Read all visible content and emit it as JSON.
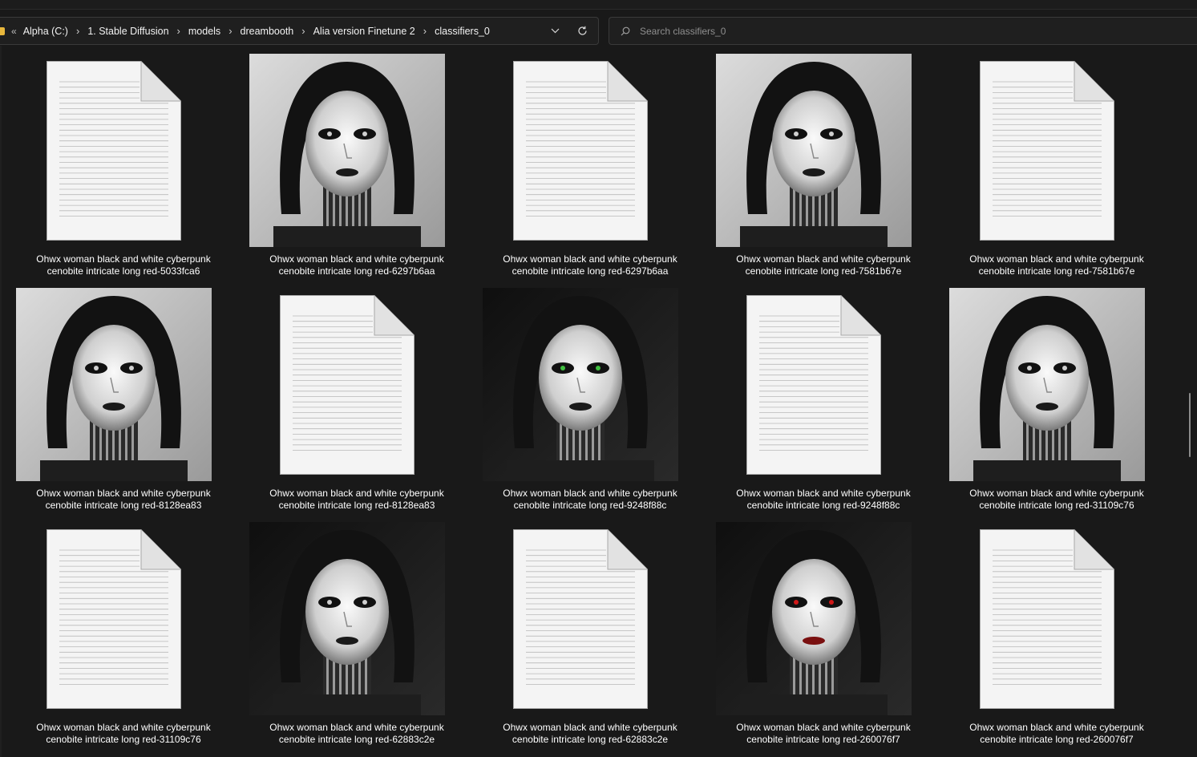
{
  "address": {
    "overflow_symbol": "«",
    "crumbs": [
      {
        "label": "Alpha (C:)"
      },
      {
        "label": "1. Stable Diffusion"
      },
      {
        "label": "models"
      },
      {
        "label": "dreambooth"
      },
      {
        "label": "Alia version Finetune 2"
      },
      {
        "label": "classifiers_0"
      }
    ]
  },
  "search": {
    "placeholder": "Search classifiers_0"
  },
  "files": [
    {
      "line1": "Ohwx woman black and white cyberpunk",
      "line2": "cenobite intricate long red-5033fca6",
      "kind": "text-file"
    },
    {
      "line1": "Ohwx woman black and white cyberpunk",
      "line2": "cenobite intricate long red-6297b6aa",
      "kind": "image"
    },
    {
      "line1": "Ohwx woman black and white cyberpunk",
      "line2": "cenobite intricate long red-6297b6aa",
      "kind": "text-file"
    },
    {
      "line1": "Ohwx woman black and white cyberpunk",
      "line2": "cenobite intricate long red-7581b67e",
      "kind": "image"
    },
    {
      "line1": "Ohwx woman black and white cyberpunk",
      "line2": "cenobite intricate long red-7581b67e",
      "kind": "text-file"
    },
    {
      "line1": "Ohwx woman black and white cyberpunk",
      "line2": "cenobite intricate long red-8128ea83",
      "kind": "image"
    },
    {
      "line1": "Ohwx woman black and white cyberpunk",
      "line2": "cenobite intricate long red-8128ea83",
      "kind": "text-file"
    },
    {
      "line1": "Ohwx woman black and white cyberpunk",
      "line2": "cenobite intricate long red-9248f88c",
      "kind": "image"
    },
    {
      "line1": "Ohwx woman black and white cyberpunk",
      "line2": "cenobite intricate long red-9248f88c",
      "kind": "text-file"
    },
    {
      "line1": "Ohwx woman black and white cyberpunk",
      "line2": "cenobite intricate long red-31109c76",
      "kind": "image"
    },
    {
      "line1": "Ohwx woman black and white cyberpunk",
      "line2": "cenobite intricate long red-31109c76",
      "kind": "text-file"
    },
    {
      "line1": "Ohwx woman black and white cyberpunk",
      "line2": "cenobite intricate long red-62883c2e",
      "kind": "image"
    },
    {
      "line1": "Ohwx woman black and white cyberpunk",
      "line2": "cenobite intricate long red-62883c2e",
      "kind": "text-file"
    },
    {
      "line1": "Ohwx woman black and white cyberpunk",
      "line2": "cenobite intricate long red-260076f7",
      "kind": "image"
    },
    {
      "line1": "Ohwx woman black and white cyberpunk",
      "line2": "cenobite intricate long red-260076f7",
      "kind": "text-file"
    }
  ],
  "icons": {
    "folder": "folder-icon",
    "chevron": "chevron-right-icon",
    "dropdown": "chevron-down-icon",
    "refresh": "refresh-icon",
    "search": "search-icon",
    "document": "document-icon",
    "thumbnail": "image-thumbnail"
  },
  "colors": {
    "background": "#191919",
    "folder": "#e8b73c",
    "text": "#ffffff"
  }
}
